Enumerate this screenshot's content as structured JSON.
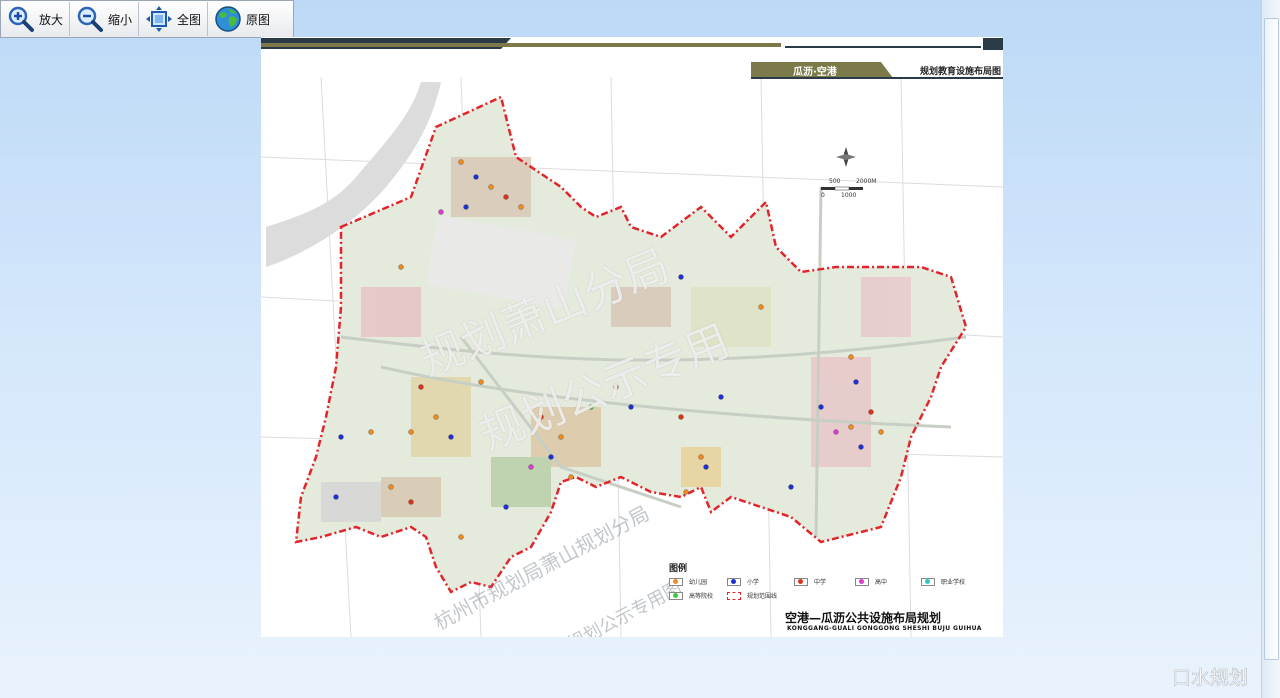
{
  "toolbar": {
    "zoom_in_label": "放大",
    "zoom_out_label": "缩小",
    "full_extent_label": "全图",
    "original_label": "原图"
  },
  "map": {
    "header_place": "瓜沥·空港",
    "sheet_title": "规划教育设施布局图",
    "legend_title": "图例",
    "legend": [
      {
        "label": "幼儿园",
        "color": "#f08a1c"
      },
      {
        "label": "小学",
        "color": "#1d2fd6"
      },
      {
        "label": "中学",
        "color": "#d8341c"
      },
      {
        "label": "高中",
        "color": "#d83cd0"
      },
      {
        "label": "职业学校",
        "color": "#31c6c4"
      },
      {
        "label": "高等院校",
        "color": "#3cc83c"
      },
      {
        "label": "规划范围线",
        "color": "#e1252a"
      }
    ],
    "footer_title": "空港—瓜沥公共设施布局规划",
    "footer_subtitle": "KONGGANG-GUALI GONGGONG SHESHI BUJU GUIHUA",
    "scale_labels": [
      "500",
      "2000M",
      "0",
      "1000"
    ],
    "watermarks": [
      "规划萧山分局",
      "规划公示专用",
      "杭州市规划局萧山规划分局",
      "规划公示专用图"
    ],
    "colors": {
      "boundary": "#e1252a",
      "band_dark": "#7c7a4a",
      "band_navy": "#2a3a46"
    }
  },
  "logo_text": "口水规划"
}
